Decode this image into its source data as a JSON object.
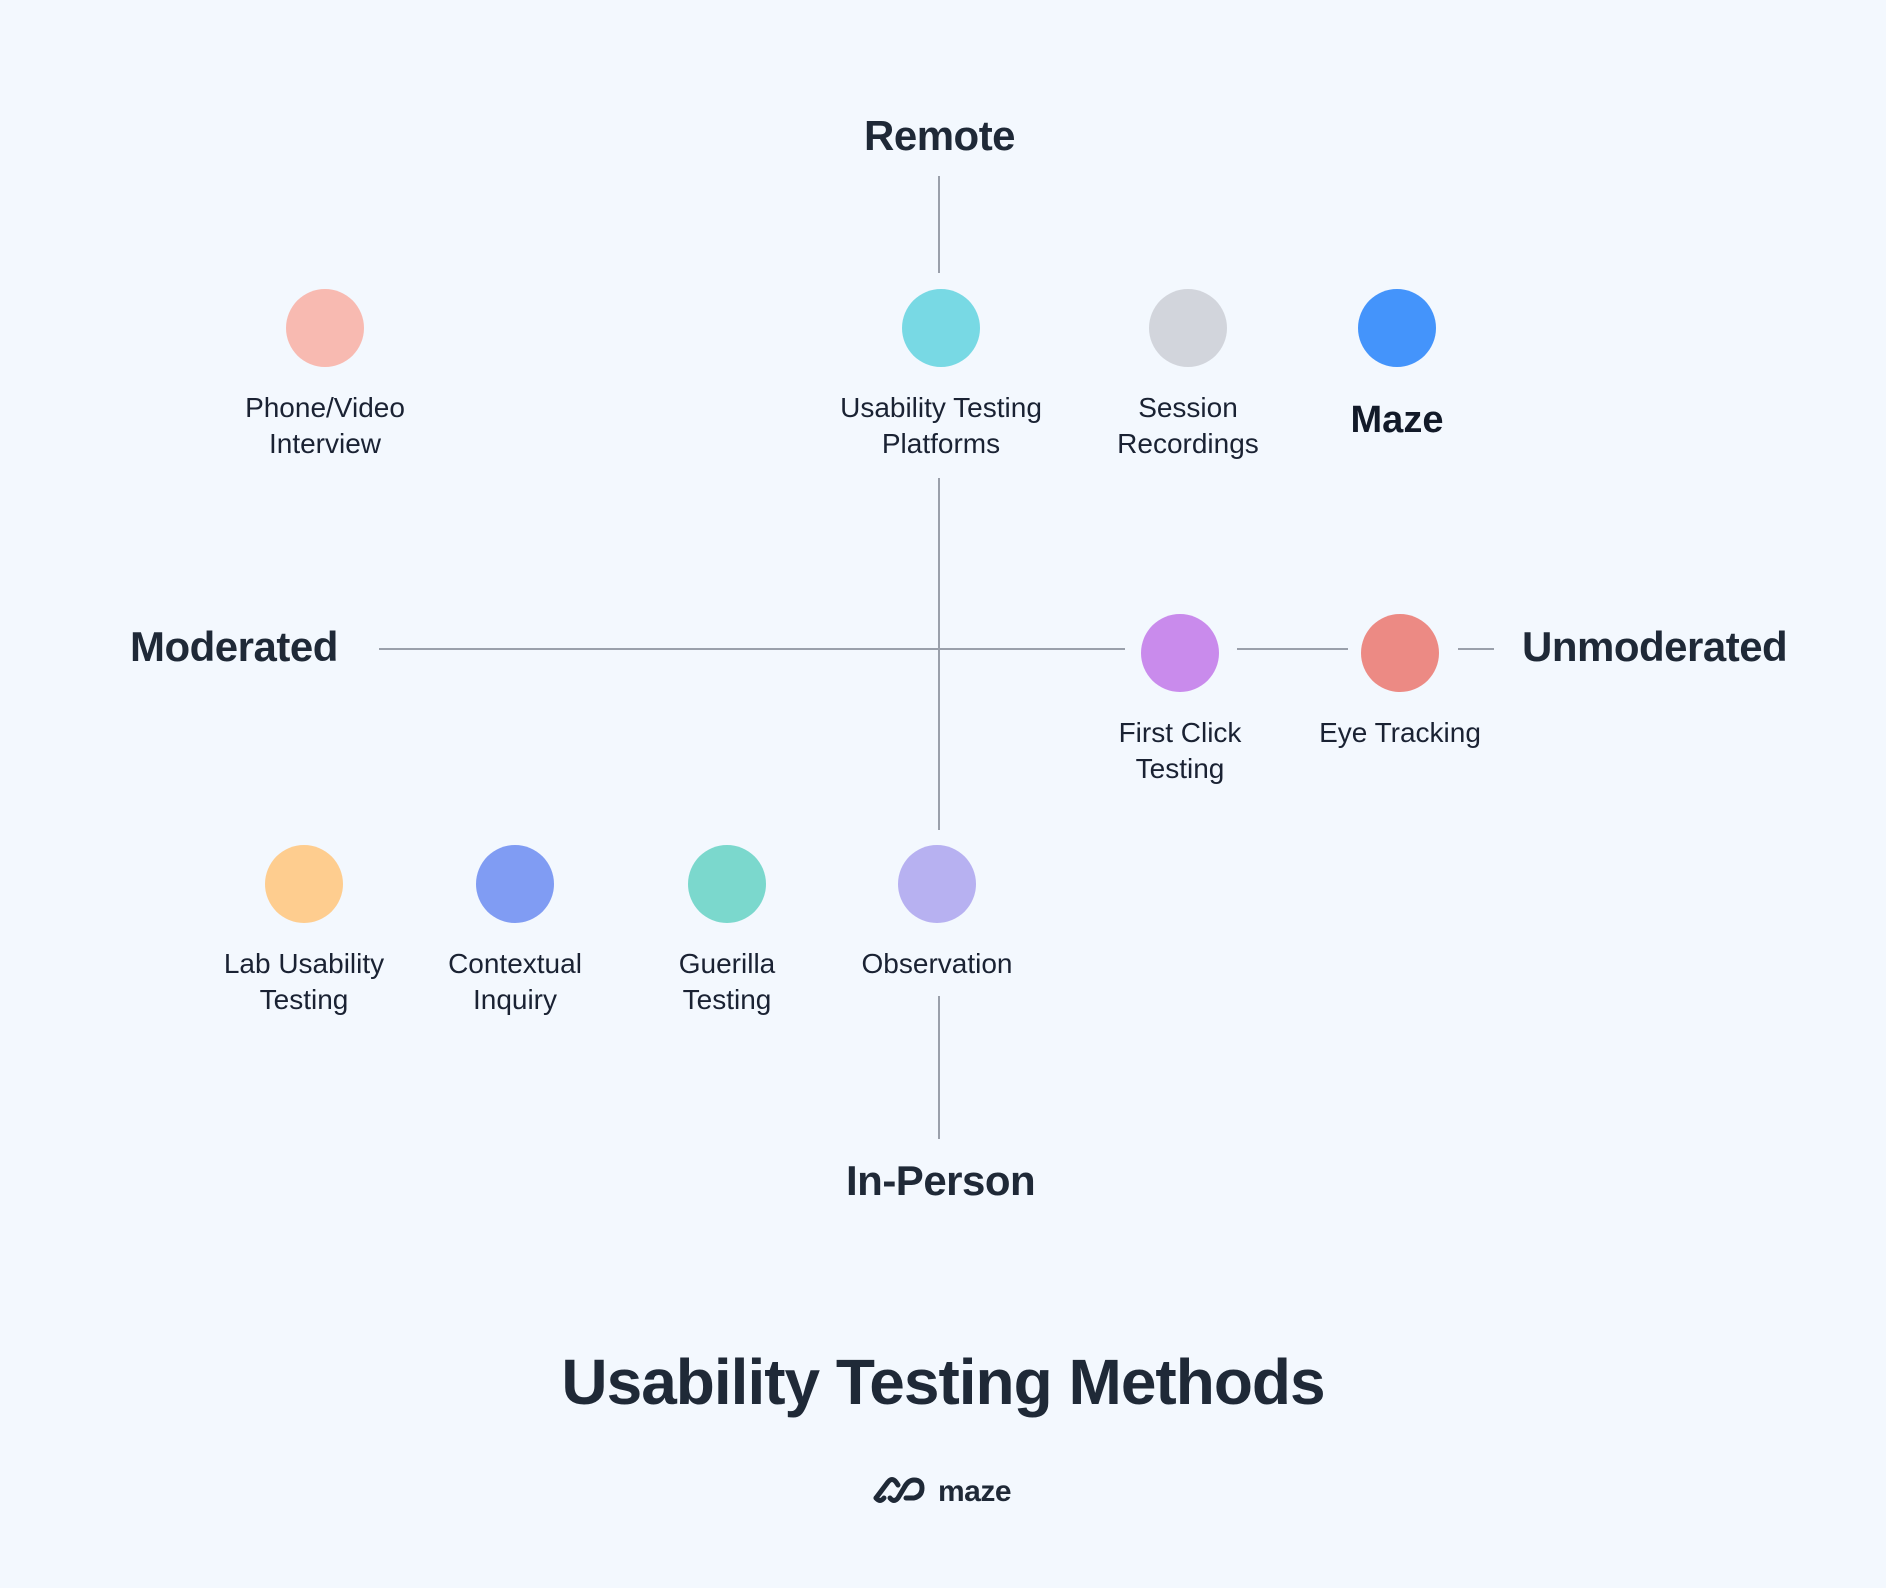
{
  "title": "Usability Testing Methods",
  "axes": {
    "top": "Remote",
    "bottom": "In-Person",
    "left": "Moderated",
    "right": "Unmoderated"
  },
  "methods": [
    {
      "lines": [
        "Phone/Video",
        "Interview"
      ],
      "color": "#f8bab1",
      "quadrant": "remote-moderated"
    },
    {
      "lines": [
        "Usability Testing",
        "Platforms"
      ],
      "color": "#78d9e4",
      "quadrant": "remote"
    },
    {
      "lines": [
        "Session",
        "Recordings"
      ],
      "color": "#d2d5dc",
      "quadrant": "remote-unmoderated"
    },
    {
      "lines": [
        "Maze",
        ""
      ],
      "color": "#4494fb",
      "quadrant": "remote-unmoderated",
      "emphasis": true
    },
    {
      "lines": [
        "First Click",
        "Testing"
      ],
      "color": "#c98bec",
      "quadrant": "unmoderated"
    },
    {
      "lines": [
        "Eye Tracking",
        ""
      ],
      "color": "#ec8a84",
      "quadrant": "unmoderated"
    },
    {
      "lines": [
        "Lab Usability",
        "Testing"
      ],
      "color": "#fecd8f",
      "quadrant": "in-person-moderated"
    },
    {
      "lines": [
        "Contextual",
        "Inquiry"
      ],
      "color": "#809cf3",
      "quadrant": "in-person-moderated"
    },
    {
      "lines": [
        "Guerilla",
        "Testing"
      ],
      "color": "#7bd8cd",
      "quadrant": "in-person-moderated"
    },
    {
      "lines": [
        "Observation",
        ""
      ],
      "color": "#b7b1f1",
      "quadrant": "in-person"
    }
  ],
  "logo": {
    "icon": "maze-logo-icon",
    "text": "maze"
  },
  "colors": {
    "background": "#f3f8fe",
    "axis": "#9aa0ab",
    "text": "#1f2937"
  }
}
